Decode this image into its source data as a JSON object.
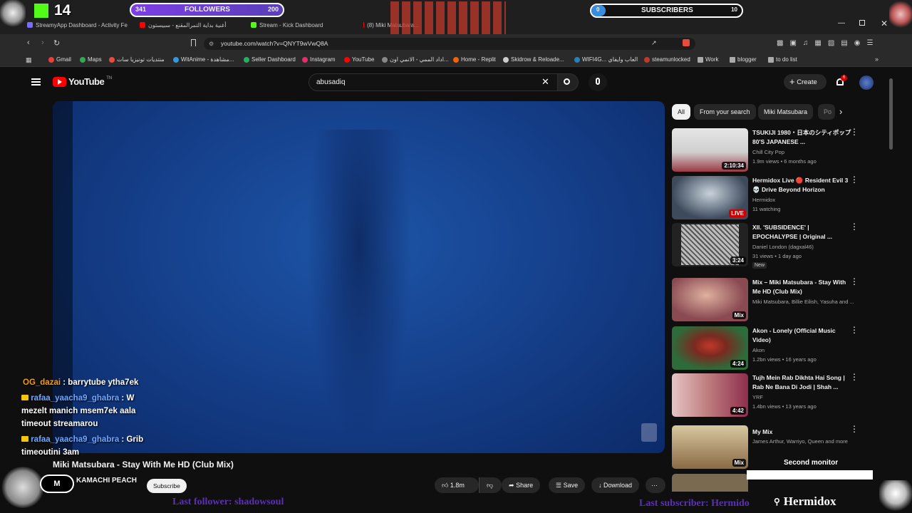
{
  "overlay": {
    "kick_count": "14",
    "followers": {
      "label": "FOLLOWERS",
      "current": "341",
      "goal": "200"
    },
    "subscribers": {
      "label": "SUBSCRIBERS",
      "current": "0",
      "goal": "10"
    },
    "brand_name": "Hermidox",
    "last_follower": "Last follower: shadowsoul",
    "last_subscriber": "Last subscriber: Hermido",
    "chat": [
      {
        "user": "OG_dazai",
        "user_color": "#f39c12",
        "message": "barrytube ytha7ek"
      },
      {
        "user": "rafaa_yaacha9_ghabra",
        "user_color": "#6ea8ff",
        "message": "W mezelt manich msem7ek aala timeout streamarou"
      },
      {
        "user": "rafaa_yaacha9_ghabra",
        "user_color": "#6ea8ff",
        "message": "Grib timeoutini 3am"
      }
    ],
    "second_monitor": "Second monitor"
  },
  "browser": {
    "tabs": [
      {
        "label": "StreamyApp Dashboard - Activity Fe",
        "color": "#7b6cff"
      },
      {
        "label": "أغنية بداية التمرالمقنع - سبيستون",
        "color": "#ff0000"
      },
      {
        "label": "Stream - Kick Dashboard",
        "color": "#53fc18"
      },
      {
        "label": "(8) Miki Matsubara...",
        "color": "#ff0000"
      }
    ],
    "url": "youtube.com/watch?v=QNYT9wVwQ8A",
    "bookmarks": [
      {
        "label": "Gmail",
        "color": "#ea4335"
      },
      {
        "label": "Maps",
        "color": "#34a853"
      },
      {
        "label": "منتديات تونيزيا سات",
        "color": "#e74c3c"
      },
      {
        "label": "WitAnime - مشاهدة...",
        "color": "#3498db"
      },
      {
        "label": "Seller Dashboard",
        "color": "#27ae60"
      },
      {
        "label": "Instagram",
        "color": "#e1306c"
      },
      {
        "label": "YouTube",
        "color": "#ff0000"
      },
      {
        "label": "اداد الممي - الانمي اون...",
        "color": "#888888"
      },
      {
        "label": "Home - Replit",
        "color": "#f26207"
      },
      {
        "label": "Skidrow & Reloade...",
        "color": "#cccccc"
      },
      {
        "label": "WIFI4G... العاب وايفاي",
        "color": "#2980b9"
      },
      {
        "label": "steamunlocked",
        "color": "#c0392b"
      },
      {
        "label": "Work",
        "color": "#aaaaaa"
      },
      {
        "label": "blogger",
        "color": "#aaaaaa"
      },
      {
        "label": "to do list",
        "color": "#aaaaaa"
      }
    ]
  },
  "youtube": {
    "logo_text": "YouTube",
    "logo_sup": "TN",
    "search_value": "abusadiq",
    "create_label": "Create",
    "notification_count": "6",
    "video_title": "Miki Matsubara - Stay With Me HD (Club Mix)",
    "channel_name": "KAMACHI PEACH",
    "subscribe_label": "Subscribe",
    "likes": "1.8m",
    "share_label": "Share",
    "save_label": "Save",
    "download_label": "Download",
    "chips": [
      "All",
      "From your search",
      "Miki Matsubara",
      "Po"
    ],
    "recommendations": [
      {
        "title": "TSUKIJI 1980・日本のシティポップ 80'S JAPANESE ...",
        "channel": "Chill City Pop",
        "meta": "1.9m views • 6 months ago",
        "badge": "2:10:34",
        "thumb_color": "#d9d9d9",
        "thumb_accent": "#b03040"
      },
      {
        "title": "Hermidox Live 🔴 Resident Evil 3 💀 Drive Beyond Horizon",
        "channel": "Hermidox",
        "meta": "11 watching",
        "badge": "LIVE",
        "thumb_color": "#3c4a5c",
        "thumb_accent": "#c8d2dc"
      },
      {
        "title": "XII. 'SUBSIDENCE' | EPOCHALYPSE | Original ...",
        "channel": "Daniel London (dagxal46)",
        "meta": "31 views • 1 day ago",
        "extra": "New",
        "badge": "3:24",
        "thumb_color": "#bdbdbd",
        "thumb_accent": "#555555"
      },
      {
        "title": "Mix – Miki Matsubara - Stay With Me HD (Club Mix)",
        "channel": "Miki Matsubara, Billie Eilish, Yasuha and ...",
        "meta": "",
        "badge": "Mix",
        "thumb_color": "#8a4a52",
        "thumb_accent": "#e0b0a0"
      },
      {
        "title": "Akon - Lonely (Official Music Video)",
        "channel": "Akon",
        "meta": "1.2bn views • 16 years ago",
        "badge": "4:24",
        "thumb_color": "#2e6b3a",
        "thumb_accent": "#c0392b"
      },
      {
        "title": "Tujh Mein Rab Dikhta Hai Song | Rab Ne Bana Di Jodi | Shah ...",
        "channel": "YRF",
        "meta": "1.4bn views • 13 years ago",
        "badge": "4:42",
        "thumb_color": "#e6c5c5",
        "thumb_accent": "#8e2e4e"
      },
      {
        "title": "My Mix",
        "channel": "James Arthur, Warriyo, Queen and more",
        "meta": "",
        "badge": "Mix",
        "thumb_color": "#8a6a45",
        "thumb_accent": "#d8c8a0"
      }
    ]
  },
  "colors": {
    "kick_green": "#53fc18",
    "youtube_red": "#ff0000",
    "overlay_purple": "#7b3fe4",
    "page_bg": "#0f0f0f"
  }
}
